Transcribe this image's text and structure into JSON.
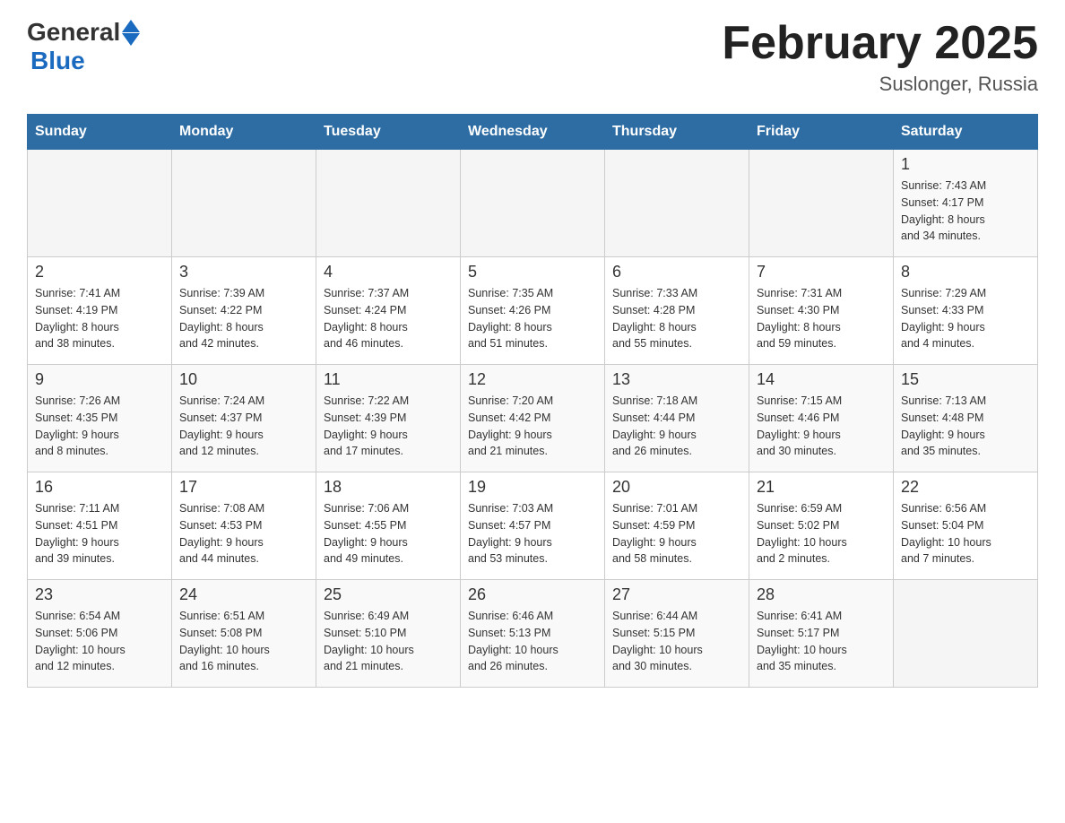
{
  "header": {
    "logo_general": "General",
    "logo_blue": "Blue",
    "month_title": "February 2025",
    "location": "Suslonger, Russia"
  },
  "weekdays": [
    "Sunday",
    "Monday",
    "Tuesday",
    "Wednesday",
    "Thursday",
    "Friday",
    "Saturday"
  ],
  "weeks": [
    [
      {
        "day": "",
        "info": ""
      },
      {
        "day": "",
        "info": ""
      },
      {
        "day": "",
        "info": ""
      },
      {
        "day": "",
        "info": ""
      },
      {
        "day": "",
        "info": ""
      },
      {
        "day": "",
        "info": ""
      },
      {
        "day": "1",
        "info": "Sunrise: 7:43 AM\nSunset: 4:17 PM\nDaylight: 8 hours\nand 34 minutes."
      }
    ],
    [
      {
        "day": "2",
        "info": "Sunrise: 7:41 AM\nSunset: 4:19 PM\nDaylight: 8 hours\nand 38 minutes."
      },
      {
        "day": "3",
        "info": "Sunrise: 7:39 AM\nSunset: 4:22 PM\nDaylight: 8 hours\nand 42 minutes."
      },
      {
        "day": "4",
        "info": "Sunrise: 7:37 AM\nSunset: 4:24 PM\nDaylight: 8 hours\nand 46 minutes."
      },
      {
        "day": "5",
        "info": "Sunrise: 7:35 AM\nSunset: 4:26 PM\nDaylight: 8 hours\nand 51 minutes."
      },
      {
        "day": "6",
        "info": "Sunrise: 7:33 AM\nSunset: 4:28 PM\nDaylight: 8 hours\nand 55 minutes."
      },
      {
        "day": "7",
        "info": "Sunrise: 7:31 AM\nSunset: 4:30 PM\nDaylight: 8 hours\nand 59 minutes."
      },
      {
        "day": "8",
        "info": "Sunrise: 7:29 AM\nSunset: 4:33 PM\nDaylight: 9 hours\nand 4 minutes."
      }
    ],
    [
      {
        "day": "9",
        "info": "Sunrise: 7:26 AM\nSunset: 4:35 PM\nDaylight: 9 hours\nand 8 minutes."
      },
      {
        "day": "10",
        "info": "Sunrise: 7:24 AM\nSunset: 4:37 PM\nDaylight: 9 hours\nand 12 minutes."
      },
      {
        "day": "11",
        "info": "Sunrise: 7:22 AM\nSunset: 4:39 PM\nDaylight: 9 hours\nand 17 minutes."
      },
      {
        "day": "12",
        "info": "Sunrise: 7:20 AM\nSunset: 4:42 PM\nDaylight: 9 hours\nand 21 minutes."
      },
      {
        "day": "13",
        "info": "Sunrise: 7:18 AM\nSunset: 4:44 PM\nDaylight: 9 hours\nand 26 minutes."
      },
      {
        "day": "14",
        "info": "Sunrise: 7:15 AM\nSunset: 4:46 PM\nDaylight: 9 hours\nand 30 minutes."
      },
      {
        "day": "15",
        "info": "Sunrise: 7:13 AM\nSunset: 4:48 PM\nDaylight: 9 hours\nand 35 minutes."
      }
    ],
    [
      {
        "day": "16",
        "info": "Sunrise: 7:11 AM\nSunset: 4:51 PM\nDaylight: 9 hours\nand 39 minutes."
      },
      {
        "day": "17",
        "info": "Sunrise: 7:08 AM\nSunset: 4:53 PM\nDaylight: 9 hours\nand 44 minutes."
      },
      {
        "day": "18",
        "info": "Sunrise: 7:06 AM\nSunset: 4:55 PM\nDaylight: 9 hours\nand 49 minutes."
      },
      {
        "day": "19",
        "info": "Sunrise: 7:03 AM\nSunset: 4:57 PM\nDaylight: 9 hours\nand 53 minutes."
      },
      {
        "day": "20",
        "info": "Sunrise: 7:01 AM\nSunset: 4:59 PM\nDaylight: 9 hours\nand 58 minutes."
      },
      {
        "day": "21",
        "info": "Sunrise: 6:59 AM\nSunset: 5:02 PM\nDaylight: 10 hours\nand 2 minutes."
      },
      {
        "day": "22",
        "info": "Sunrise: 6:56 AM\nSunset: 5:04 PM\nDaylight: 10 hours\nand 7 minutes."
      }
    ],
    [
      {
        "day": "23",
        "info": "Sunrise: 6:54 AM\nSunset: 5:06 PM\nDaylight: 10 hours\nand 12 minutes."
      },
      {
        "day": "24",
        "info": "Sunrise: 6:51 AM\nSunset: 5:08 PM\nDaylight: 10 hours\nand 16 minutes."
      },
      {
        "day": "25",
        "info": "Sunrise: 6:49 AM\nSunset: 5:10 PM\nDaylight: 10 hours\nand 21 minutes."
      },
      {
        "day": "26",
        "info": "Sunrise: 6:46 AM\nSunset: 5:13 PM\nDaylight: 10 hours\nand 26 minutes."
      },
      {
        "day": "27",
        "info": "Sunrise: 6:44 AM\nSunset: 5:15 PM\nDaylight: 10 hours\nand 30 minutes."
      },
      {
        "day": "28",
        "info": "Sunrise: 6:41 AM\nSunset: 5:17 PM\nDaylight: 10 hours\nand 35 minutes."
      },
      {
        "day": "",
        "info": ""
      }
    ]
  ]
}
